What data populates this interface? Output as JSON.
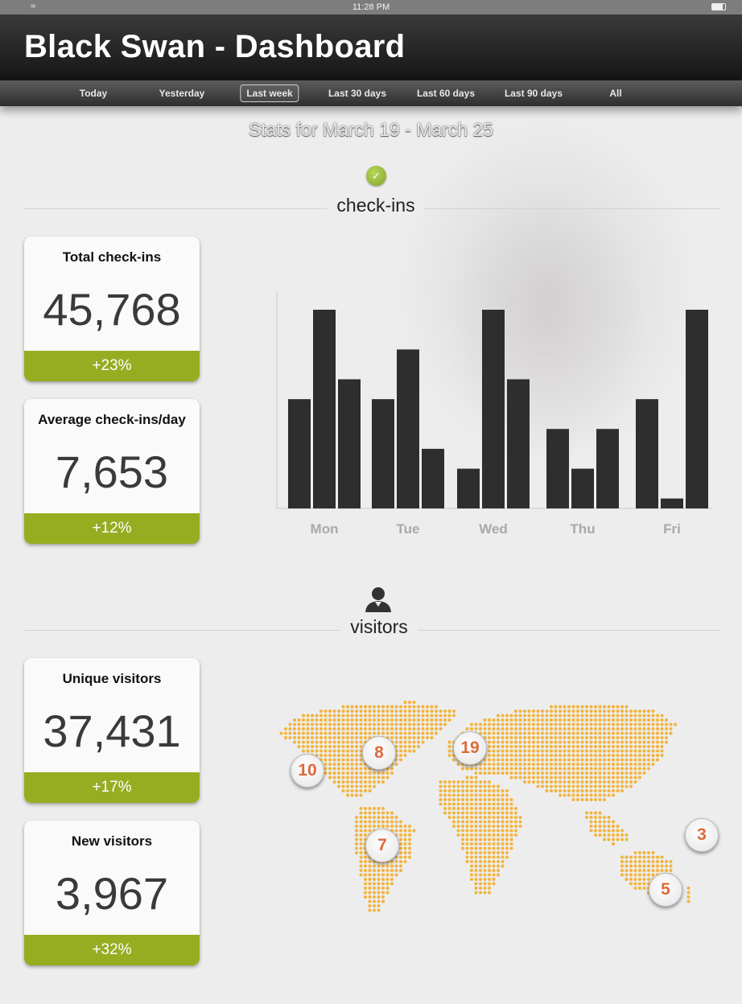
{
  "status_bar": {
    "time": "11:28 PM"
  },
  "header": {
    "title": "Black Swan - Dashboard"
  },
  "nav": {
    "tabs": [
      "Today",
      "Yesterday",
      "Last week",
      "Last 30 days",
      "Last 60 days",
      "Last 90 days",
      "All"
    ],
    "active": "Last week"
  },
  "range_title": "Stats for March 19 - March 25",
  "checkins": {
    "section_label": "check-ins",
    "cards": [
      {
        "label": "Total check-ins",
        "value": "45,768",
        "change": "+23%"
      },
      {
        "label": "Average check-ins/day",
        "value": "7,653",
        "change": "+12%"
      }
    ]
  },
  "visitors": {
    "section_label": "visitors",
    "cards": [
      {
        "label": "Unique visitors",
        "value": "37,431",
        "change": "+17%"
      },
      {
        "label": "New visitors",
        "value": "3,967",
        "change": "+32%"
      }
    ],
    "map_pins": [
      {
        "value": "10",
        "region": "north-america-west"
      },
      {
        "value": "8",
        "region": "north-america-east"
      },
      {
        "value": "19",
        "region": "europe"
      },
      {
        "value": "7",
        "region": "south-america"
      },
      {
        "value": "3",
        "region": "new-zealand"
      },
      {
        "value": "5",
        "region": "australia"
      }
    ]
  },
  "colors": {
    "accent_green": "#96ad22",
    "bar": "#2e2e2e",
    "map_dots": "#f3b43d",
    "pin_number": "#dd6a3a"
  },
  "chart_data": {
    "type": "bar",
    "categories": [
      "Mon",
      "Tue",
      "Wed",
      "Thu",
      "Fri"
    ],
    "series": [
      {
        "values": [
          55,
          55,
          20,
          40,
          55
        ]
      },
      {
        "values": [
          100,
          80,
          100,
          20,
          5
        ]
      },
      {
        "values": [
          65,
          30,
          65,
          40,
          100
        ]
      }
    ],
    "ylim": [
      0,
      100
    ],
    "grid": false
  },
  "icons": {
    "checkins": "check-icon",
    "visitors": "person-icon"
  }
}
